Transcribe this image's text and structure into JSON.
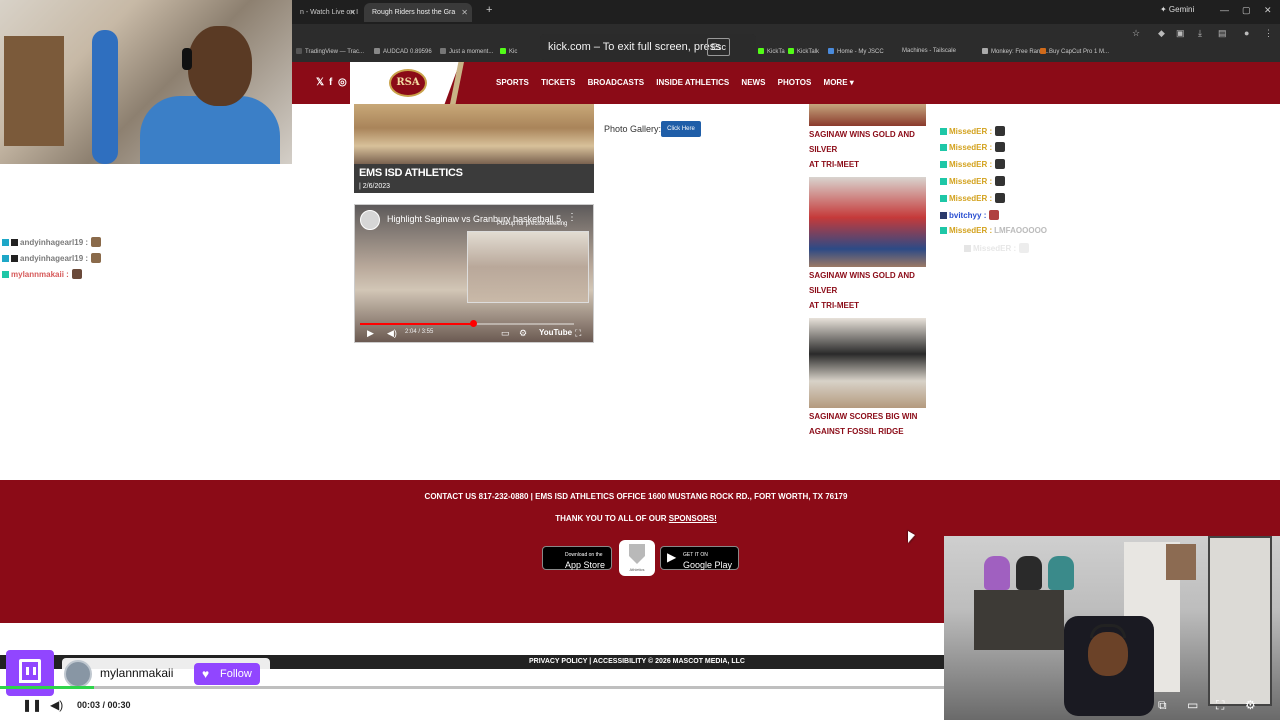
{
  "browser": {
    "tabs": [
      {
        "label": "n - Watch Live on I",
        "active": false
      },
      {
        "label": "Rough Riders host the Gra",
        "active": true
      }
    ],
    "new_tab_icon": "plus-icon",
    "gemini_label": "✦ Gemini",
    "bookmarks": [
      "TradingView — Trac...",
      "AUDCAD 0.89596",
      "Just a moment...",
      "Kic",
      "KickTa",
      "KickTalk",
      "Home - My JSCC",
      "Machines - Tailscale",
      "Monkey: Free Rand...",
      "Buy CapCut Pro 1 M..."
    ],
    "fullscreen_toast": {
      "text": "kick.com – To exit full screen, press",
      "key": "Esc"
    }
  },
  "site": {
    "logo_text": "RSA",
    "nav": [
      "SPORTS",
      "TICKETS",
      "BROADCASTS",
      "INSIDE ATHLETICS",
      "NEWS",
      "PHOTOS",
      "MORE ▾"
    ],
    "tile": {
      "title": "EMS ISD ATHLETICS",
      "date": "| 2/6/2023"
    },
    "video": {
      "title": "Highlight Saginaw vs Granbury basketball 5",
      "pip_hint": "Pull up for precise seeking",
      "time": "2:04 / 3:55",
      "brand": "YouTube",
      "progress": 0.53
    },
    "gallery": {
      "label": "Photo Gallery:",
      "button": "Click Here"
    },
    "news": [
      {
        "title1": "SAGINAW WINS GOLD AND SILVER",
        "title2": "AT TRI-MEET"
      },
      {
        "title1": "SAGINAW WINS GOLD AND SILVER",
        "title2": "AT TRI-MEET"
      },
      {
        "title1": "SAGINAW SCORES BIG WIN",
        "title2": "AGAINST FOSSIL RIDGE"
      }
    ],
    "footer": {
      "contact": "CONTACT US 817-232-0880 | EMS ISD ATHLETICS OFFICE 1600 MUSTANG ROCK RD., FORT WORTH, TX 76179",
      "thanks_prefix": "THANK YOU TO ALL OF OUR ",
      "thanks_link": "SPONSORS!",
      "app_store": {
        "small": "Download on the",
        "big": "App Store"
      },
      "app_icon_label": "Athletics",
      "google_play": {
        "small": "GET IT ON",
        "big": "Google Play"
      },
      "legal": "PRIVACY POLICY | ACCESSIBILITY © 2026 MASCOT MEDIA, LLC"
    }
  },
  "overlay_chat": {
    "left": [
      {
        "user": "andyinhagearl19",
        "sep": " :",
        "color": "#7a7a7a"
      },
      {
        "user": "andyinhagearl19",
        "sep": " :",
        "color": "#7a7a7a"
      },
      {
        "user": "mylannmakaii",
        "sep": " :",
        "color": "#d65a5a"
      }
    ],
    "right": [
      {
        "user": "MissedER",
        "sep": " :",
        "color": "#d3a21e",
        "msg": ""
      },
      {
        "user": "MissedER",
        "sep": " :",
        "color": "#d3a21e",
        "msg": ""
      },
      {
        "user": "MissedER",
        "sep": " :",
        "color": "#d3a21e",
        "msg": ""
      },
      {
        "user": "MissedER",
        "sep": " :",
        "color": "#d3a21e",
        "msg": ""
      },
      {
        "user": "MissedER",
        "sep": " :",
        "color": "#d3a21e",
        "msg": ""
      },
      {
        "user": "bvitchyy",
        "sep": " :",
        "color": "#2a4fd1",
        "msg": ""
      },
      {
        "user": "MissedER",
        "sep": " :",
        "color": "#d3a21e",
        "msg": "LMFAOOOOO"
      },
      {
        "user": "MissedER",
        "sep": " :",
        "color": "#cfcfcf",
        "msg": ""
      }
    ]
  },
  "player": {
    "channel": "mylannmakaii",
    "follow_label": "Follow",
    "time": "00:03 / 00:30",
    "progress": 0.1,
    "accent": "#9146ff",
    "icons": [
      "pause-icon",
      "volume-icon",
      "pip-icon",
      "theater-icon",
      "fullscreen-icon",
      "settings-icon"
    ]
  },
  "colors": {
    "brand_red": "#8b0b17",
    "gold": "#c9b386",
    "twitch_purple": "#9146ff"
  }
}
